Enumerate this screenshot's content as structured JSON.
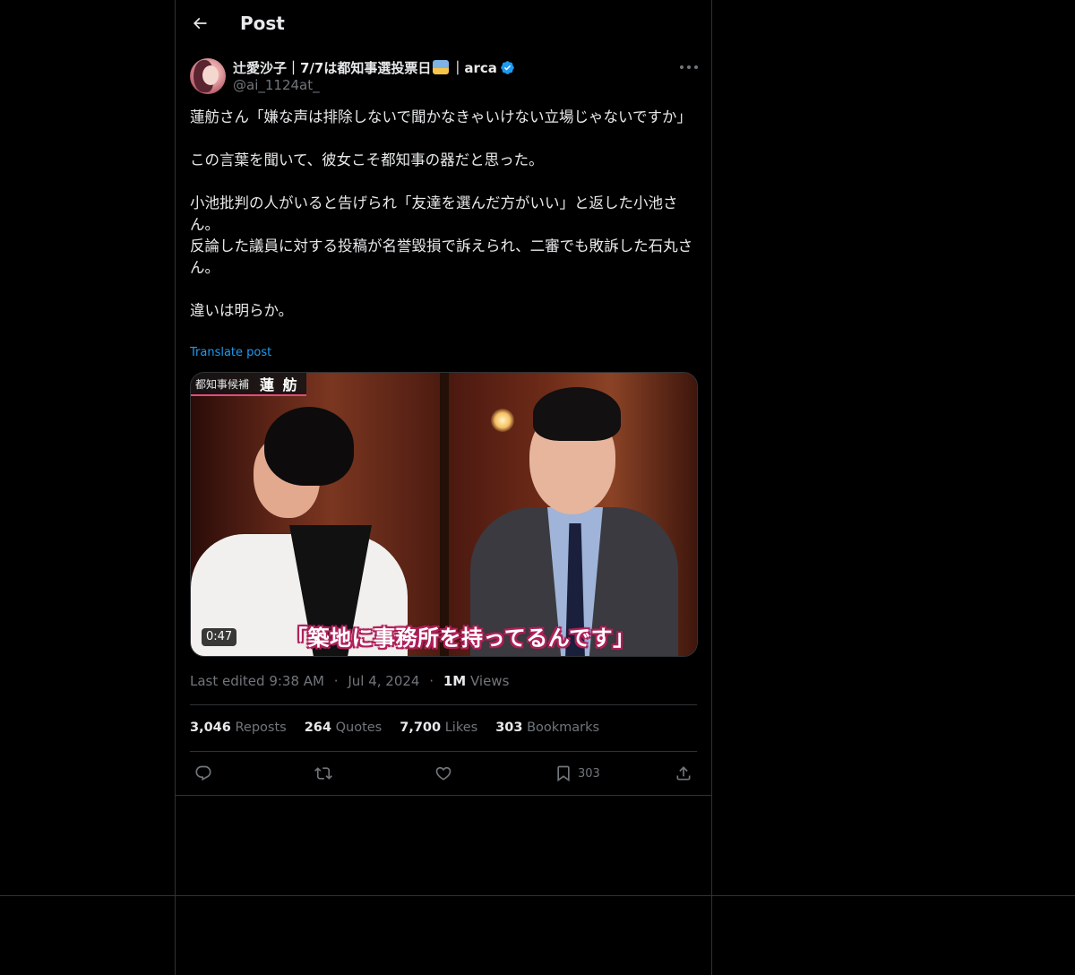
{
  "header": {
    "title": "Post"
  },
  "author": {
    "display_name": "辻愛沙子｜7/7は都知事選投票日",
    "display_name_tail": "｜arca",
    "handle": "@ai_1124at_",
    "verified": true,
    "emoji": "ballot-box-emoji"
  },
  "post": {
    "lines": [
      "蓮舫さん「嫌な声は排除しないで聞かなきゃいけない立場じゃないですか」",
      "",
      "この言葉を聞いて、彼女こそ都知事の器だと思った。",
      "",
      "小池批判の人がいると告げられ「友達を選んだ方がいい」と返した小池さん。",
      "反論した議員に対する投稿が名誉毀損で訴えられ、二審でも敗訴した石丸さん。",
      "",
      "違いは明らか。"
    ],
    "translate_label": "Translate post"
  },
  "media": {
    "caption_small": "都知事候補",
    "caption_big": "蓮 舫",
    "subtitle": "「築地に事務所を持ってるんです」",
    "duration": "0:47"
  },
  "meta": {
    "edited": "Last edited 9:38 AM",
    "date": "Jul 4, 2024",
    "views_count": "1M",
    "views_label": "Views",
    "separator": "·"
  },
  "stats": {
    "reposts": {
      "num": "3,046",
      "label": "Reposts"
    },
    "quotes": {
      "num": "264",
      "label": "Quotes"
    },
    "likes": {
      "num": "7,700",
      "label": "Likes"
    },
    "bookmarks": {
      "num": "303",
      "label": "Bookmarks"
    }
  },
  "actions": {
    "bookmark_count": "303"
  },
  "colors": {
    "background": "#000000",
    "text": "#e7e9ea",
    "muted": "#71767b",
    "accent": "#1d9bf0",
    "border": "#2f3336"
  }
}
